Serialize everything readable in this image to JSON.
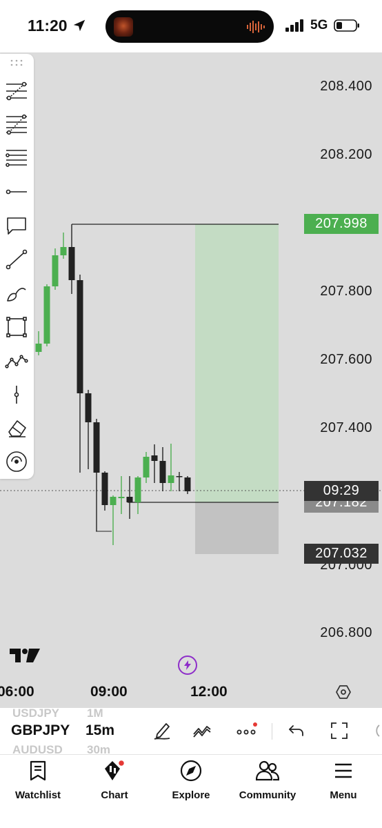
{
  "status_bar": {
    "time": "11:20",
    "network": "5G"
  },
  "chart": {
    "price_axis": [
      "208.400",
      "208.200",
      "207.800",
      "207.600",
      "207.400",
      "207.000",
      "206.800"
    ],
    "tags": {
      "take_profit": "207.998",
      "crosshair_time": "09:29",
      "entry": "207.182",
      "stop_loss": "207.032"
    },
    "time_axis": [
      "06:00",
      "09:00",
      "12:00"
    ],
    "colors": {
      "up": "#4caf50",
      "down": "#222222",
      "profit_zone": "#c4dcc4",
      "loss_zone": "#c2c2c2",
      "tag_green": "#4caf50",
      "tag_dark": "#333333"
    }
  },
  "toolbar": {
    "tools": [
      "grip-icon",
      "fib-retracement-icon",
      "fib-extension-icon",
      "parallel-lines-icon",
      "horizontal-ray-icon",
      "callout-icon",
      "trend-line-icon",
      "brush-icon",
      "rectangle-icon",
      "pattern-icon",
      "vertical-line-icon",
      "eraser-icon",
      "magnet-icon"
    ]
  },
  "symbol_bar": {
    "symbol": "GBPJPY",
    "interval": "15m",
    "prev_symbol": "USDJPY",
    "next_symbol": "AUDUSD",
    "prev_interval": "1M",
    "next_interval": "30m"
  },
  "tabs": [
    {
      "label": "Watchlist",
      "icon": "watchlist-icon"
    },
    {
      "label": "Chart",
      "icon": "chart-icon"
    },
    {
      "label": "Explore",
      "icon": "compass-icon"
    },
    {
      "label": "Community",
      "icon": "community-icon"
    },
    {
      "label": "Menu",
      "icon": "menu-icon"
    }
  ]
}
